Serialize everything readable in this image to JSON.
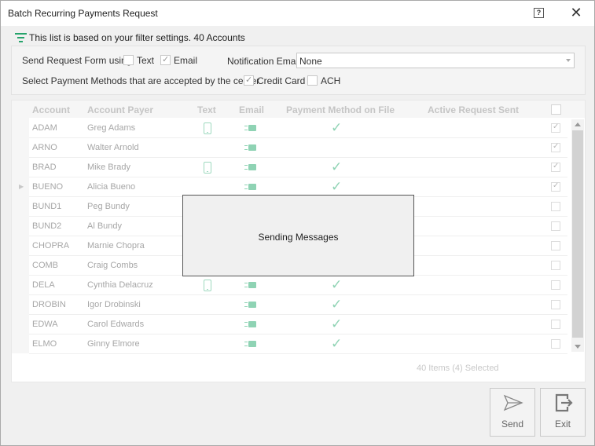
{
  "window": {
    "title": "Batch Recurring Payments Request",
    "help_label": "?",
    "close_label": "✕"
  },
  "filter": {
    "text": "This list is based on your filter settings. 40 Accounts"
  },
  "options": {
    "send_form_label": "Send Request Form using",
    "text_label": "Text",
    "text_checked": false,
    "email_label": "Email",
    "email_checked": true,
    "notification_email_label": "Notification Email",
    "notification_email_value": "None",
    "payment_methods_label": "Select Payment Methods that are accepted by the center",
    "credit_card_label": "Credit Card",
    "credit_card_checked": true,
    "ach_label": "ACH",
    "ach_checked": false
  },
  "grid": {
    "columns": [
      "Account",
      "Account Payer",
      "Text",
      "Email",
      "Payment Method on File",
      "Active Request Sent"
    ],
    "rows": [
      {
        "account": "ADAM",
        "payer": "Greg Adams",
        "text": true,
        "email": true,
        "payment_method": true,
        "selected": true,
        "current": false
      },
      {
        "account": "ARNO",
        "payer": "Walter Arnold",
        "text": false,
        "email": true,
        "payment_method": false,
        "selected": true,
        "current": false
      },
      {
        "account": "BRAD",
        "payer": "Mike Brady",
        "text": true,
        "email": true,
        "payment_method": true,
        "selected": true,
        "current": false
      },
      {
        "account": "BUENO",
        "payer": "Alicia Bueno",
        "text": false,
        "email": true,
        "payment_method": true,
        "selected": true,
        "current": true
      },
      {
        "account": "BUND1",
        "payer": "Peg Bundy",
        "text": false,
        "email": false,
        "payment_method": false,
        "selected": false,
        "current": false
      },
      {
        "account": "BUND2",
        "payer": "Al Bundy",
        "text": false,
        "email": false,
        "payment_method": false,
        "selected": false,
        "current": false
      },
      {
        "account": "CHOPRA",
        "payer": "Marnie Chopra",
        "text": false,
        "email": false,
        "payment_method": false,
        "selected": false,
        "current": false
      },
      {
        "account": "COMB",
        "payer": "Craig Combs",
        "text": false,
        "email": false,
        "payment_method": false,
        "selected": false,
        "current": false
      },
      {
        "account": "DELA",
        "payer": "Cynthia Delacruz",
        "text": true,
        "email": true,
        "payment_method": true,
        "selected": false,
        "current": false
      },
      {
        "account": "DROBIN",
        "payer": "Igor Drobinski",
        "text": false,
        "email": true,
        "payment_method": true,
        "selected": false,
        "current": false
      },
      {
        "account": "EDWA",
        "payer": "Carol Edwards",
        "text": false,
        "email": true,
        "payment_method": true,
        "selected": false,
        "current": false
      },
      {
        "account": "ELMO",
        "payer": "Ginny Elmore",
        "text": false,
        "email": true,
        "payment_method": true,
        "selected": false,
        "current": false
      }
    ],
    "footer": "40 Items (4) Selected"
  },
  "overlay": {
    "message": "Sending Messages"
  },
  "buttons": {
    "send_label": "Send",
    "exit_label": "Exit"
  },
  "colors": {
    "accent": "#26a36b",
    "icon_tint": "#8fd3b4"
  }
}
